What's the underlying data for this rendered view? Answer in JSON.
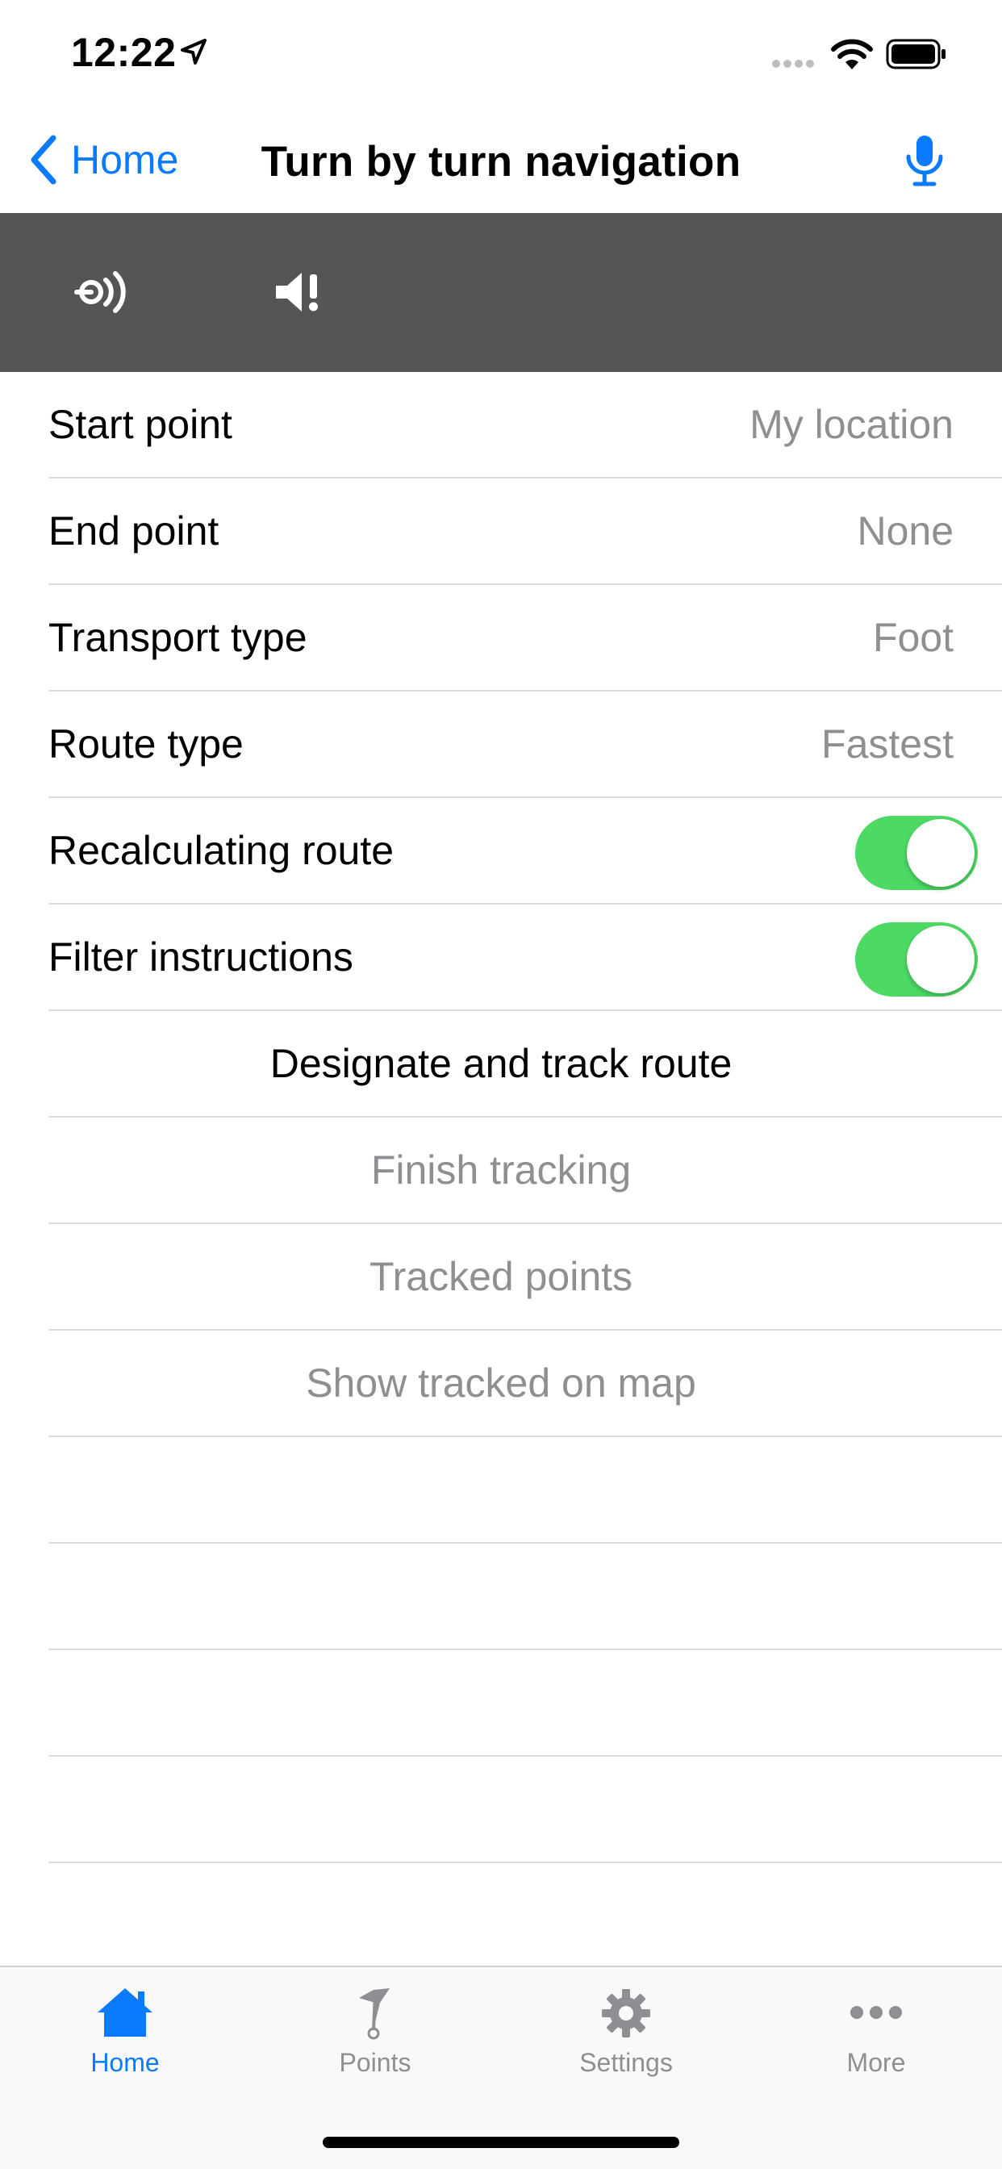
{
  "status_bar": {
    "time": "12:22"
  },
  "nav": {
    "back_label": "Home",
    "title": "Turn by turn navigation"
  },
  "toolbar": {
    "buttons": [
      "audio-beacon-icon",
      "speaker-alert-icon"
    ]
  },
  "settings": {
    "start_point": {
      "label": "Start point",
      "value": "My location"
    },
    "end_point": {
      "label": "End point",
      "value": "None"
    },
    "transport_type": {
      "label": "Transport type",
      "value": "Foot"
    },
    "route_type": {
      "label": "Route type",
      "value": "Fastest"
    },
    "recalculating_route": {
      "label": "Recalculating route",
      "on": true
    },
    "filter_instructions": {
      "label": "Filter instructions",
      "on": true
    }
  },
  "actions": {
    "designate": "Designate and track route",
    "finish": "Finish tracking",
    "tracked_points": "Tracked points",
    "show_on_map": "Show tracked on map"
  },
  "tabs": [
    {
      "label": "Home",
      "icon": "house-icon",
      "active": true
    },
    {
      "label": "Points",
      "icon": "flag-icon",
      "active": false
    },
    {
      "label": "Settings",
      "icon": "gear-icon",
      "active": false
    },
    {
      "label": "More",
      "icon": "ellipsis-icon",
      "active": false
    }
  ],
  "colors": {
    "accent": "#0a7aff",
    "toggle_on": "#4cd964",
    "toolbar_bg": "#555555",
    "secondary_text": "#8e8e93"
  }
}
